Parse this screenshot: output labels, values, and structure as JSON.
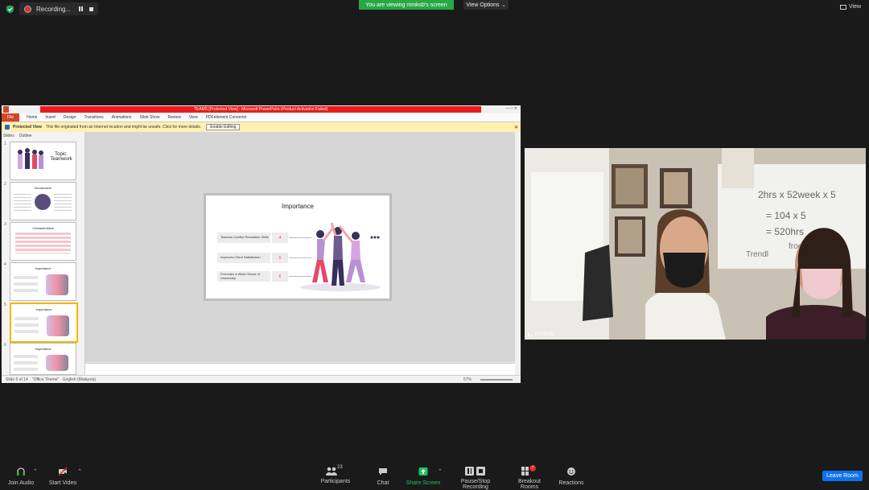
{
  "top_bar": {
    "recording_label": "Recording...",
    "viewing_banner": "You are viewing mmksb's screen",
    "view_options": "View Options",
    "view_label": "View"
  },
  "ppt": {
    "title": "TEAMS [Protected View] - Microsoft PowerPoint (Product Activation Failed)",
    "tabs": [
      "File",
      "Home",
      "Insert",
      "Design",
      "Transitions",
      "Animations",
      "Slide Show",
      "Review",
      "View",
      "PDFelement Converter"
    ],
    "protected_label": "Protected View",
    "protected_msg": "This file originated from an Internet location and might be unsafe. Click for more details.",
    "enable_editing": "Enable Editing",
    "left_tabs": [
      "Slides",
      "Outline"
    ],
    "thumbnails": [
      {
        "num": "1",
        "title": "Topic: Teamwork"
      },
      {
        "num": "2",
        "title": "Introduction"
      },
      {
        "num": "3",
        "title": "Characteristics"
      },
      {
        "num": "4",
        "title": "Importance"
      },
      {
        "num": "5",
        "title": "Importance"
      },
      {
        "num": "6",
        "title": "Importance"
      }
    ],
    "slide": {
      "title": "Importance",
      "rows": [
        {
          "text": "Teaches Conflict Resolution Skills",
          "num": "4"
        },
        {
          "text": "Improves Client Satisfaction",
          "num": "5"
        },
        {
          "text": "Promotes a Wider Sense of Ownership",
          "num": "6"
        }
      ]
    },
    "status": {
      "slide": "Slide 5 of 14",
      "theme": "\"Office Theme\"",
      "language": "English (Malaysia)",
      "zoom": "57%"
    }
  },
  "video": {
    "name": "mmksb"
  },
  "toolbar": {
    "join_audio": "Join Audio",
    "start_video": "Start Video",
    "participants": "Participants",
    "participants_count": "23",
    "chat": "Chat",
    "share_screen": "Share Screen",
    "pause_stop": "Pause/Stop Recording",
    "breakout": "Breakout Rooms",
    "breakout_badge": "7",
    "reactions": "Reactions",
    "leave": "Leave Room"
  },
  "colors": {
    "accent_green": "#28a745",
    "leave_blue": "#0e72ed",
    "ppt_red": "#e81c1c"
  }
}
